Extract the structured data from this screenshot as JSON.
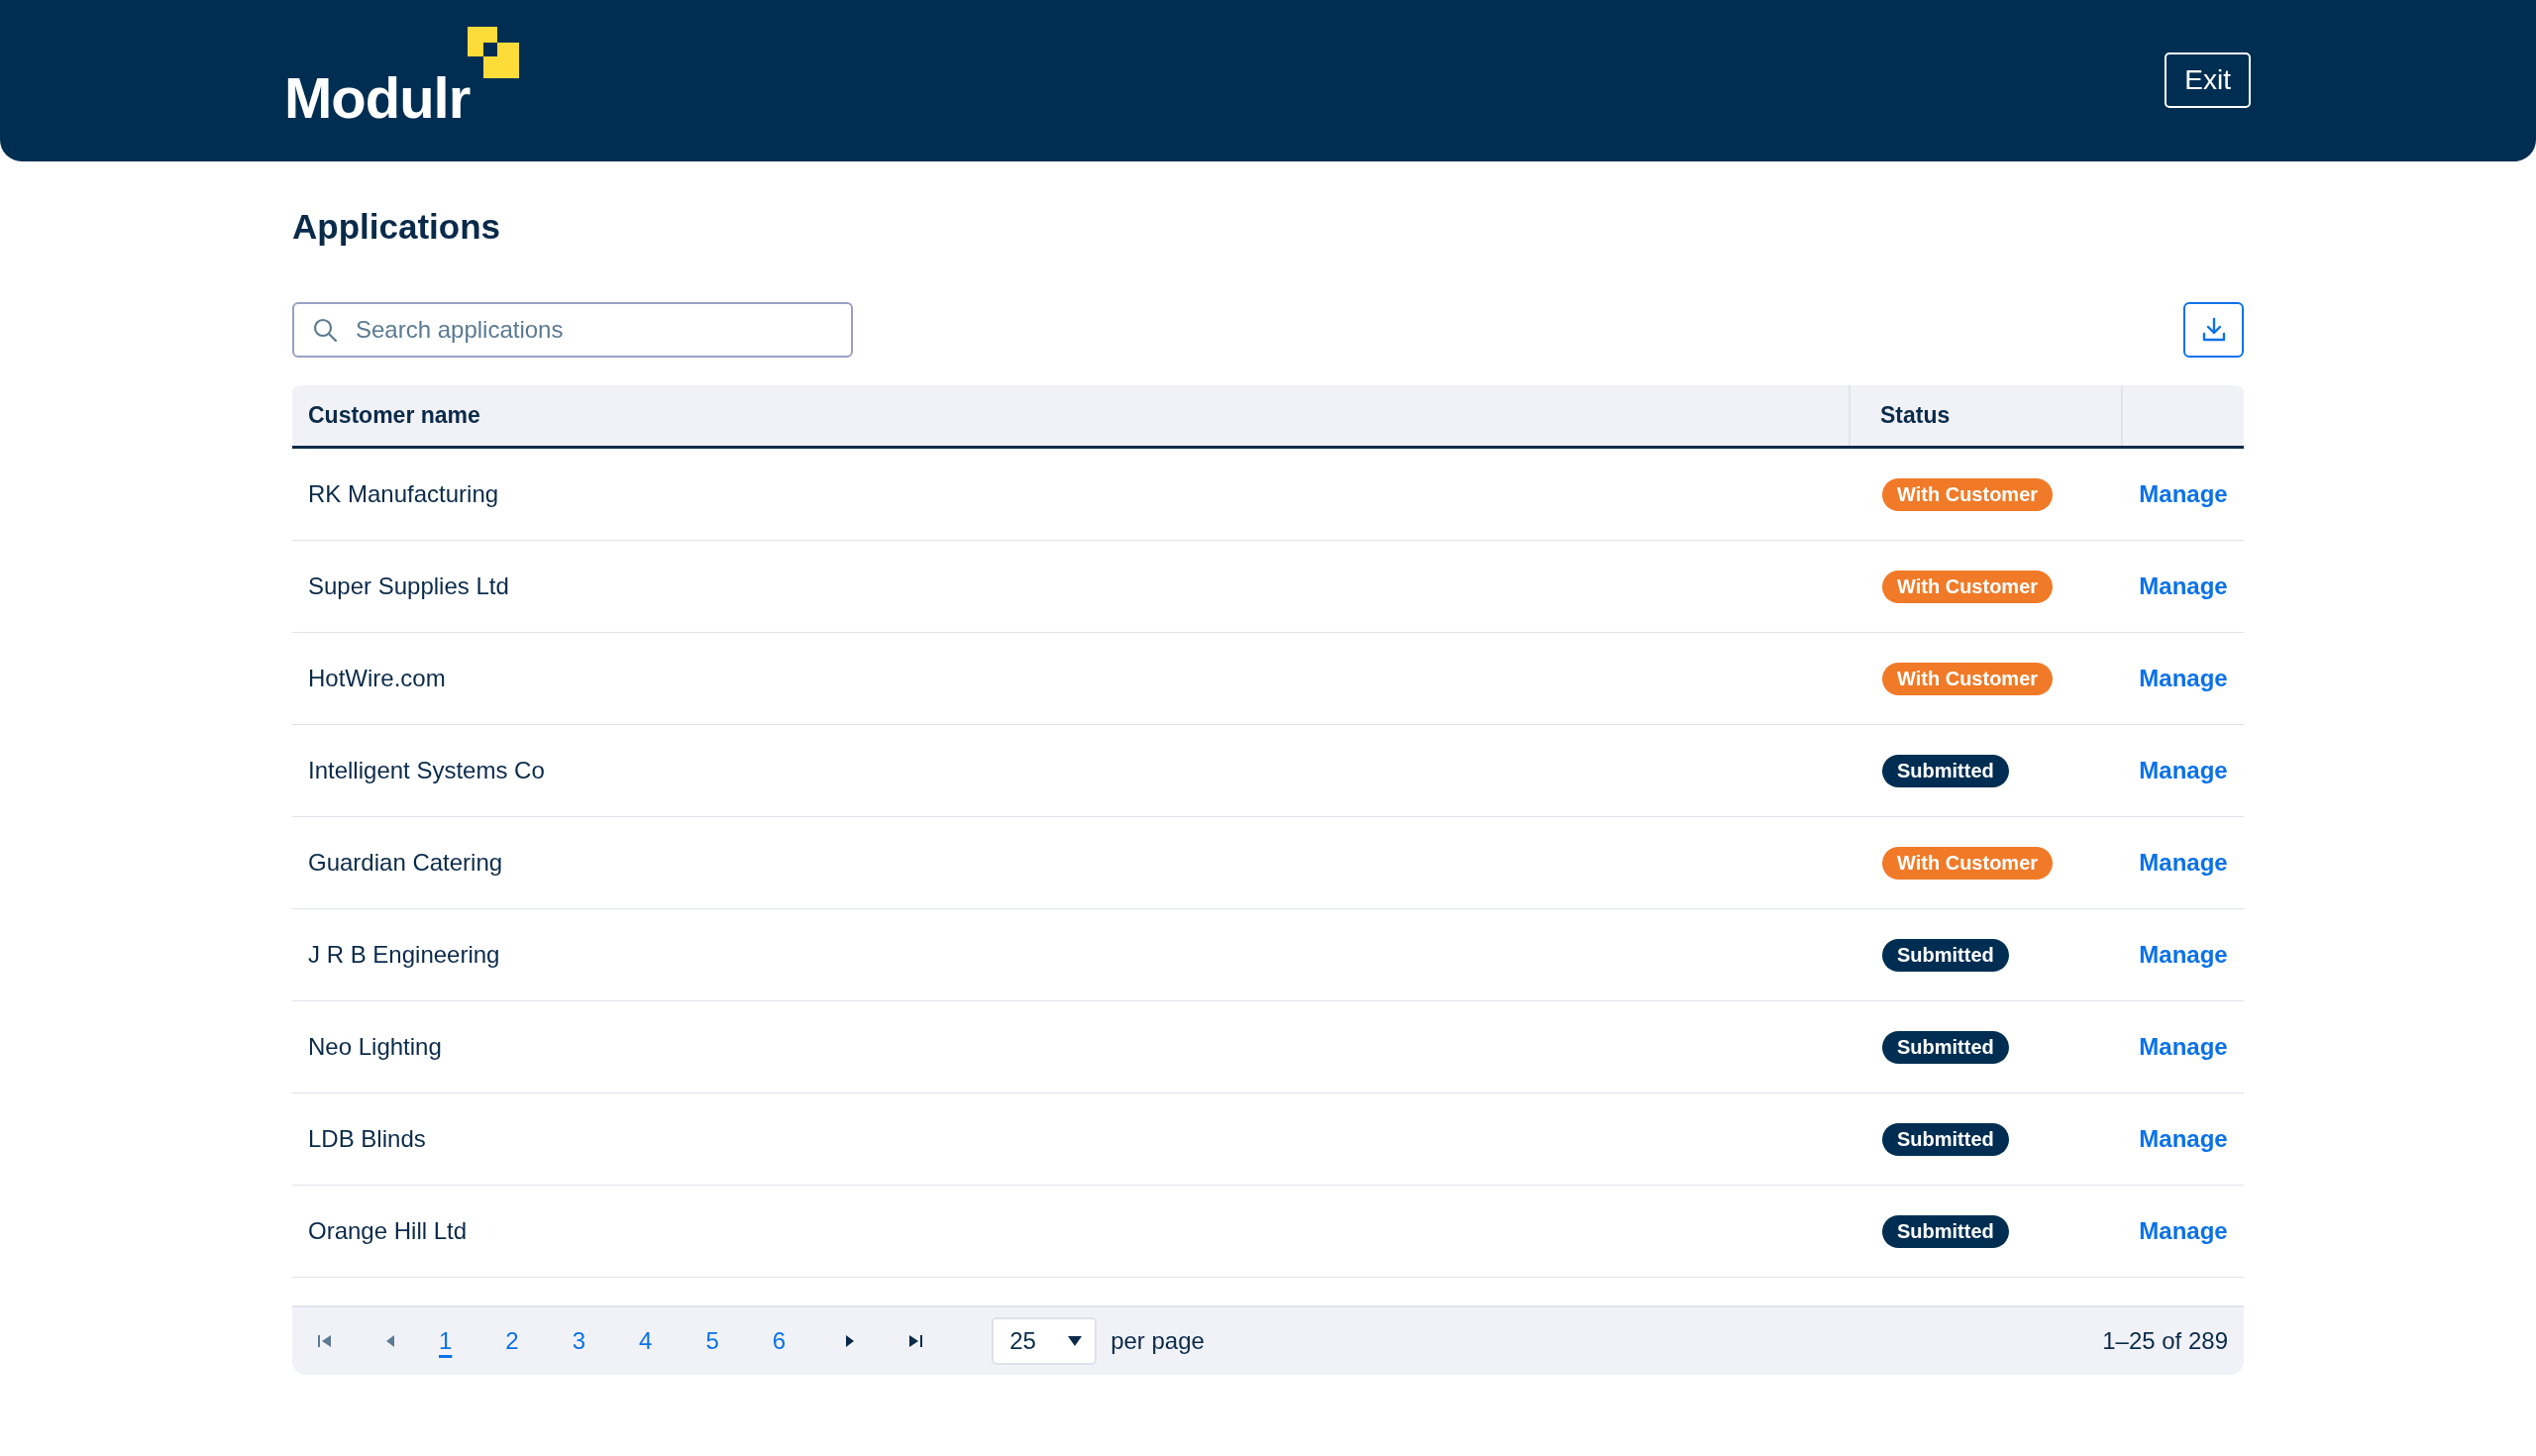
{
  "header": {
    "logo": "Modulr",
    "exit_button": "Exit"
  },
  "page_title": "Applications",
  "search": {
    "placeholder": "Search applications"
  },
  "table": {
    "columns": [
      "Customer name",
      "Status"
    ],
    "rows": [
      {
        "name": "RK Manufacturing",
        "status": "With Customer",
        "color": "#f07a28",
        "action": "Manage"
      },
      {
        "name": "Super Supplies Ltd",
        "status": "With Customer",
        "color": "#f07a28",
        "action": "Manage"
      },
      {
        "name": "HotWire.com",
        "status": "With Customer",
        "color": "#f07a28",
        "action": "Manage"
      },
      {
        "name": "Intelligent Systems Co",
        "status": "Submitted",
        "color": "#002e52",
        "action": "Manage"
      },
      {
        "name": "Guardian Catering",
        "status": "With Customer",
        "color": "#f07a28",
        "action": "Manage"
      },
      {
        "name": "J R B Engineering",
        "status": "Submitted",
        "color": "#002e52",
        "action": "Manage"
      },
      {
        "name": "Neo Lighting",
        "status": "Submitted",
        "color": "#002e52",
        "action": "Manage"
      },
      {
        "name": "LDB Blinds",
        "status": "Submitted",
        "color": "#002e52",
        "action": "Manage"
      },
      {
        "name": "Orange Hill Ltd",
        "status": "Submitted",
        "color": "#002e52",
        "action": "Manage"
      }
    ]
  },
  "pagination": {
    "first_disabled": true,
    "prev_disabled": true,
    "pages": [
      {
        "label": "1",
        "selected": true
      },
      {
        "label": "2",
        "selected": false
      },
      {
        "label": "3",
        "selected": false
      },
      {
        "label": "4",
        "selected": false
      },
      {
        "label": "5",
        "selected": false
      },
      {
        "label": "6",
        "selected": false
      }
    ],
    "next_disabled": false,
    "last_disabled": false,
    "per_page_value": "25",
    "per_page_label": "per page",
    "range": "1–25 of 289"
  }
}
